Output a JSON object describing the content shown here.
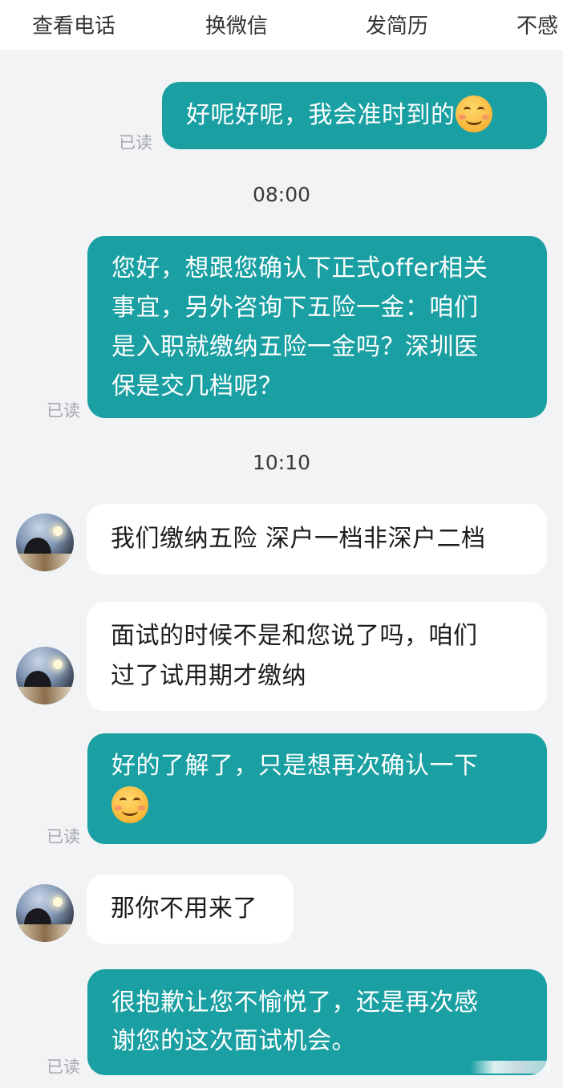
{
  "topbar": {
    "items": [
      "查看电话",
      "换微信",
      "发简历",
      "不感"
    ]
  },
  "messages": {
    "m1": {
      "text": "好呢好呢，我会准时到的",
      "read": "已读"
    },
    "t1": "08:00",
    "m2": {
      "line1": "您好，想跟您确认下正式offer相关",
      "line2": "事宜，另外咨询下五险一金：咱们",
      "line3": "是入职就缴纳五险一金吗？深圳医",
      "line4": "保是交几档呢？",
      "read": "已读"
    },
    "t2": "10:10",
    "m3": {
      "text": "我们缴纳五险 深户一档非深户二档"
    },
    "m4": {
      "line1": "面试的时候不是和您说了吗，咱们",
      "line2": "过了试用期才缴纳"
    },
    "m5": {
      "text": "好的了解了，只是想再次确认一下",
      "read": "已读"
    },
    "m6": {
      "text": "那你不用来了"
    },
    "m7": {
      "line1": "很抱歉让您不愉悦了，还是再次感",
      "line2": "谢您的这次面试机会。",
      "read": "已读"
    }
  },
  "icons": {
    "emoji": "smiling-face-icon",
    "avatar": "contact-avatar"
  },
  "colors": {
    "bubble_right": "#1a9fa2",
    "bubble_left": "#ffffff",
    "background": "#f2f3f5"
  }
}
